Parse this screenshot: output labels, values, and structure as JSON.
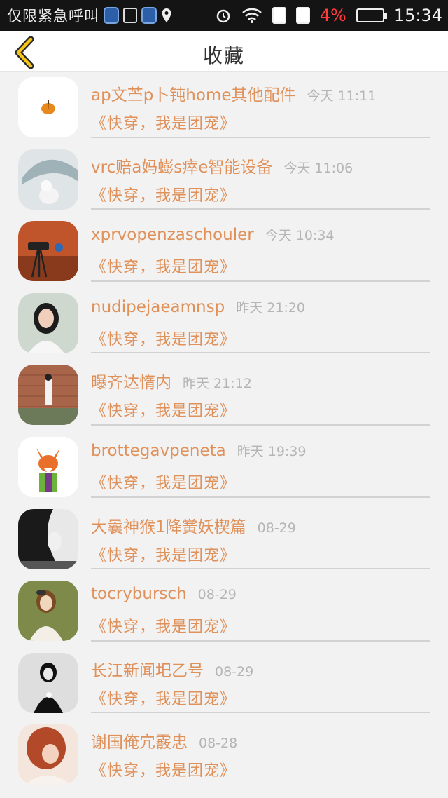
{
  "status_bar": {
    "carrier": "仅限紧急呼叫",
    "battery_percent": "4%",
    "time": "15:34"
  },
  "header": {
    "title": "收藏"
  },
  "favorites": [
    {
      "author": "ap文苎p卜钝home其他配件",
      "time": "今天 11:11",
      "book": "《快穿，我是团宠》",
      "avatar": "pumpkin"
    },
    {
      "author": "vrc赔a妈蟛s瘁e智能设备",
      "time": "今天 11:06",
      "book": "《快穿，我是团宠》",
      "avatar": "umbrella"
    },
    {
      "author": "xprvopenzaschouler",
      "time": "今天 10:34",
      "book": "《快穿，我是团宠》",
      "avatar": "camera"
    },
    {
      "author": "nudipejaeamnsp",
      "time": "昨天 21:20",
      "book": "《快穿，我是团宠》",
      "avatar": "girl-white"
    },
    {
      "author": "曝齐达惰内",
      "time": "昨天 21:12",
      "book": "《快穿，我是团宠》",
      "avatar": "brick-wall"
    },
    {
      "author": "brottegavpeneta",
      "time": "昨天 19:39",
      "book": "《快穿，我是团宠》",
      "avatar": "fox"
    },
    {
      "author": "大曩神猴1降黉妖楔篇",
      "time": "08-29",
      "book": "《快穿，我是团宠》",
      "avatar": "bw-portrait"
    },
    {
      "author": "tocrybursch",
      "time": "08-29",
      "book": "《快穿，我是团宠》",
      "avatar": "little-girl"
    },
    {
      "author": "长江新闻圯乙号",
      "time": "08-29",
      "book": "《快穿，我是团宠》",
      "avatar": "bw-girl"
    },
    {
      "author": "谢国俺宂霰忠",
      "time": "08-28",
      "book": "《快穿，我是团宠》",
      "avatar": "red-hair"
    }
  ]
}
